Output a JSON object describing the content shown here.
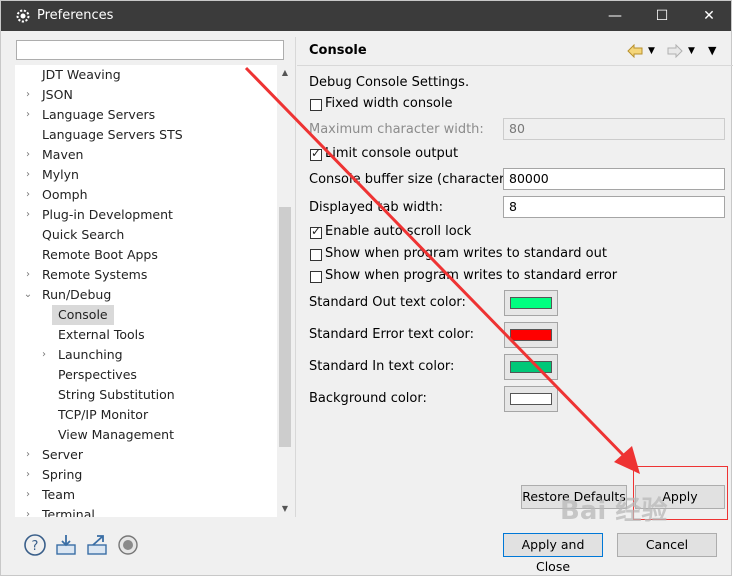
{
  "window": {
    "title": "Preferences",
    "minimize_glyph": "—",
    "maximize_glyph": "☐",
    "close_glyph": "✕"
  },
  "search": {
    "placeholder": ""
  },
  "tree": [
    {
      "label": "JDT Weaving",
      "twisty": ""
    },
    {
      "label": "JSON",
      "twisty": "›"
    },
    {
      "label": "Language Servers",
      "twisty": "›"
    },
    {
      "label": "Language Servers STS",
      "twisty": ""
    },
    {
      "label": "Maven",
      "twisty": "›"
    },
    {
      "label": "Mylyn",
      "twisty": "›"
    },
    {
      "label": "Oomph",
      "twisty": "›"
    },
    {
      "label": "Plug-in Development",
      "twisty": "›"
    },
    {
      "label": "Quick Search",
      "twisty": ""
    },
    {
      "label": "Remote Boot Apps",
      "twisty": ""
    },
    {
      "label": "Remote Systems",
      "twisty": "›"
    },
    {
      "label": "Run/Debug",
      "twisty": "⌄"
    },
    {
      "label": "Console",
      "twisty": "",
      "selected": true
    },
    {
      "label": "External Tools",
      "twisty": ""
    },
    {
      "label": "Launching",
      "twisty": "›"
    },
    {
      "label": "Perspectives",
      "twisty": ""
    },
    {
      "label": "String Substitution",
      "twisty": ""
    },
    {
      "label": "TCP/IP Monitor",
      "twisty": ""
    },
    {
      "label": "View Management",
      "twisty": ""
    },
    {
      "label": "Server",
      "twisty": "›"
    },
    {
      "label": "Spring",
      "twisty": "›"
    },
    {
      "label": "Team",
      "twisty": "›"
    },
    {
      "label": "Terminal",
      "twisty": "›"
    }
  ],
  "page": {
    "title": "Console",
    "description": "Debug Console Settings.",
    "fixed_width_label": "Fixed width console",
    "fixed_width_checked": false,
    "max_char_width_label": "Maximum character width:",
    "max_char_width_value": "80",
    "limit_output_label": "Limit console output",
    "limit_output_checked": true,
    "buffer_size_label": "Console buffer size (characters):",
    "buffer_size_value": "80000",
    "tab_width_label": "Displayed tab width:",
    "tab_width_value": "8",
    "auto_scroll_label": "Enable auto scroll lock",
    "auto_scroll_checked": true,
    "show_stdout_label": "Show when program writes to standard out",
    "show_stdout_checked": false,
    "show_stderr_label": "Show when program writes to standard error",
    "show_stderr_checked": false,
    "out_color_label": "Standard Out text color:",
    "out_color": "#00ff80",
    "err_color_label": "Standard Error text color:",
    "err_color": "#ff0000",
    "in_color_label": "Standard In text color:",
    "in_color": "#00c878",
    "bg_color_label": "Background color:",
    "bg_color": "#ffffff",
    "restore_defaults": "Restore Defaults",
    "apply": "Apply"
  },
  "footer": {
    "apply_and_close": "Apply and Close",
    "cancel": "Cancel"
  },
  "watermark": "Bai 经验",
  "annotation_color": "#ee3333"
}
